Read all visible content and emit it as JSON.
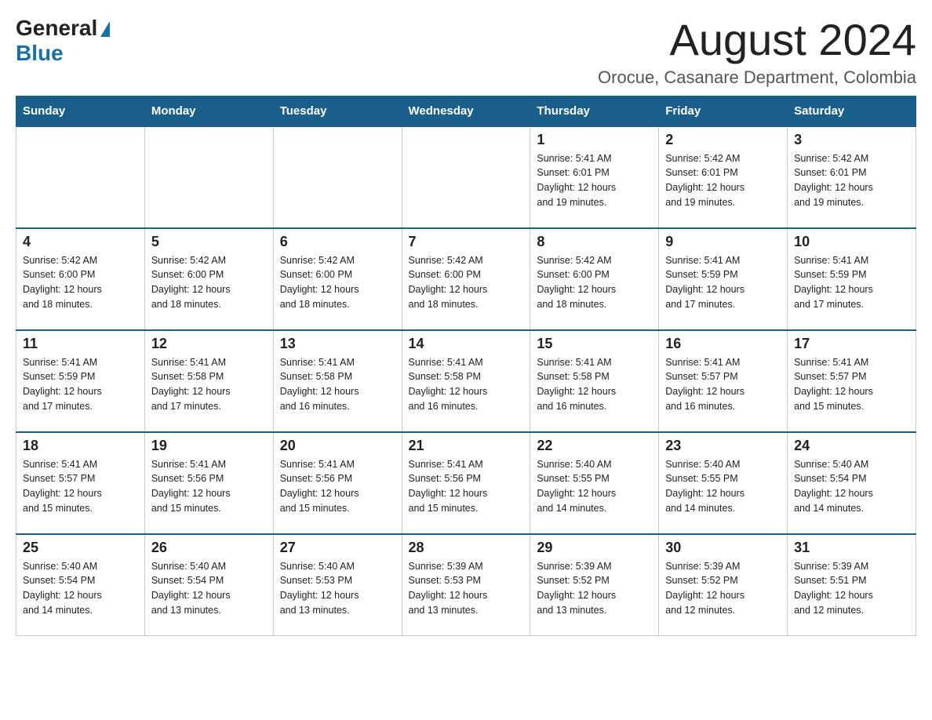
{
  "header": {
    "logo_general": "General",
    "logo_blue": "Blue",
    "main_title": "August 2024",
    "subtitle": "Orocue, Casanare Department, Colombia"
  },
  "days_of_week": [
    "Sunday",
    "Monday",
    "Tuesday",
    "Wednesday",
    "Thursday",
    "Friday",
    "Saturday"
  ],
  "weeks": [
    [
      {
        "day": "",
        "info": ""
      },
      {
        "day": "",
        "info": ""
      },
      {
        "day": "",
        "info": ""
      },
      {
        "day": "",
        "info": ""
      },
      {
        "day": "1",
        "info": "Sunrise: 5:41 AM\nSunset: 6:01 PM\nDaylight: 12 hours\nand 19 minutes."
      },
      {
        "day": "2",
        "info": "Sunrise: 5:42 AM\nSunset: 6:01 PM\nDaylight: 12 hours\nand 19 minutes."
      },
      {
        "day": "3",
        "info": "Sunrise: 5:42 AM\nSunset: 6:01 PM\nDaylight: 12 hours\nand 19 minutes."
      }
    ],
    [
      {
        "day": "4",
        "info": "Sunrise: 5:42 AM\nSunset: 6:00 PM\nDaylight: 12 hours\nand 18 minutes."
      },
      {
        "day": "5",
        "info": "Sunrise: 5:42 AM\nSunset: 6:00 PM\nDaylight: 12 hours\nand 18 minutes."
      },
      {
        "day": "6",
        "info": "Sunrise: 5:42 AM\nSunset: 6:00 PM\nDaylight: 12 hours\nand 18 minutes."
      },
      {
        "day": "7",
        "info": "Sunrise: 5:42 AM\nSunset: 6:00 PM\nDaylight: 12 hours\nand 18 minutes."
      },
      {
        "day": "8",
        "info": "Sunrise: 5:42 AM\nSunset: 6:00 PM\nDaylight: 12 hours\nand 18 minutes."
      },
      {
        "day": "9",
        "info": "Sunrise: 5:41 AM\nSunset: 5:59 PM\nDaylight: 12 hours\nand 17 minutes."
      },
      {
        "day": "10",
        "info": "Sunrise: 5:41 AM\nSunset: 5:59 PM\nDaylight: 12 hours\nand 17 minutes."
      }
    ],
    [
      {
        "day": "11",
        "info": "Sunrise: 5:41 AM\nSunset: 5:59 PM\nDaylight: 12 hours\nand 17 minutes."
      },
      {
        "day": "12",
        "info": "Sunrise: 5:41 AM\nSunset: 5:58 PM\nDaylight: 12 hours\nand 17 minutes."
      },
      {
        "day": "13",
        "info": "Sunrise: 5:41 AM\nSunset: 5:58 PM\nDaylight: 12 hours\nand 16 minutes."
      },
      {
        "day": "14",
        "info": "Sunrise: 5:41 AM\nSunset: 5:58 PM\nDaylight: 12 hours\nand 16 minutes."
      },
      {
        "day": "15",
        "info": "Sunrise: 5:41 AM\nSunset: 5:58 PM\nDaylight: 12 hours\nand 16 minutes."
      },
      {
        "day": "16",
        "info": "Sunrise: 5:41 AM\nSunset: 5:57 PM\nDaylight: 12 hours\nand 16 minutes."
      },
      {
        "day": "17",
        "info": "Sunrise: 5:41 AM\nSunset: 5:57 PM\nDaylight: 12 hours\nand 15 minutes."
      }
    ],
    [
      {
        "day": "18",
        "info": "Sunrise: 5:41 AM\nSunset: 5:57 PM\nDaylight: 12 hours\nand 15 minutes."
      },
      {
        "day": "19",
        "info": "Sunrise: 5:41 AM\nSunset: 5:56 PM\nDaylight: 12 hours\nand 15 minutes."
      },
      {
        "day": "20",
        "info": "Sunrise: 5:41 AM\nSunset: 5:56 PM\nDaylight: 12 hours\nand 15 minutes."
      },
      {
        "day": "21",
        "info": "Sunrise: 5:41 AM\nSunset: 5:56 PM\nDaylight: 12 hours\nand 15 minutes."
      },
      {
        "day": "22",
        "info": "Sunrise: 5:40 AM\nSunset: 5:55 PM\nDaylight: 12 hours\nand 14 minutes."
      },
      {
        "day": "23",
        "info": "Sunrise: 5:40 AM\nSunset: 5:55 PM\nDaylight: 12 hours\nand 14 minutes."
      },
      {
        "day": "24",
        "info": "Sunrise: 5:40 AM\nSunset: 5:54 PM\nDaylight: 12 hours\nand 14 minutes."
      }
    ],
    [
      {
        "day": "25",
        "info": "Sunrise: 5:40 AM\nSunset: 5:54 PM\nDaylight: 12 hours\nand 14 minutes."
      },
      {
        "day": "26",
        "info": "Sunrise: 5:40 AM\nSunset: 5:54 PM\nDaylight: 12 hours\nand 13 minutes."
      },
      {
        "day": "27",
        "info": "Sunrise: 5:40 AM\nSunset: 5:53 PM\nDaylight: 12 hours\nand 13 minutes."
      },
      {
        "day": "28",
        "info": "Sunrise: 5:39 AM\nSunset: 5:53 PM\nDaylight: 12 hours\nand 13 minutes."
      },
      {
        "day": "29",
        "info": "Sunrise: 5:39 AM\nSunset: 5:52 PM\nDaylight: 12 hours\nand 13 minutes."
      },
      {
        "day": "30",
        "info": "Sunrise: 5:39 AM\nSunset: 5:52 PM\nDaylight: 12 hours\nand 12 minutes."
      },
      {
        "day": "31",
        "info": "Sunrise: 5:39 AM\nSunset: 5:51 PM\nDaylight: 12 hours\nand 12 minutes."
      }
    ]
  ]
}
